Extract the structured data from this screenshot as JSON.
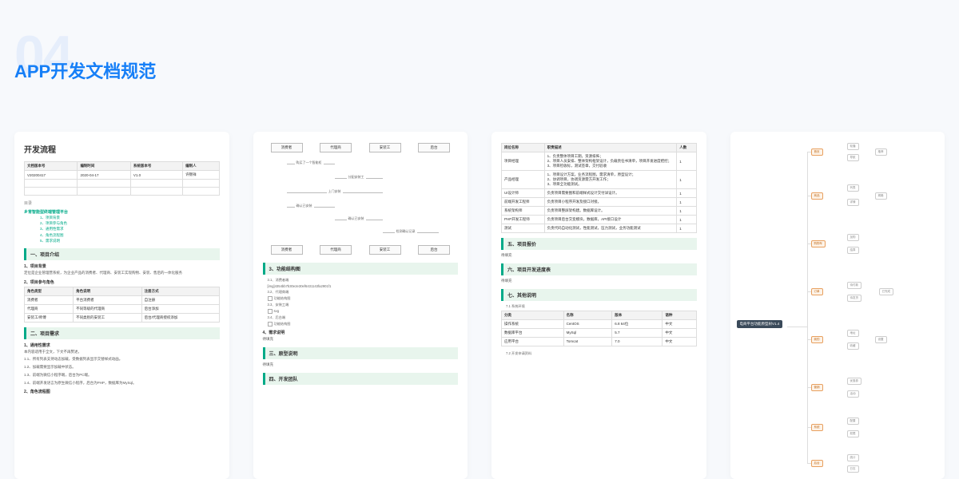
{
  "bg_number": "04",
  "title": "APP开发文档规范",
  "card1": {
    "h1": "开发流程",
    "ver_table": {
      "headers": [
        "文档版本号",
        "编制时间",
        "系统版本号",
        "编制人"
      ],
      "rows": [
        [
          "V20200417",
          "2020-04-17",
          "V1.0",
          "许锦祥"
        ],
        [
          "",
          "",
          "",
          ""
        ],
        [
          "",
          "",
          "",
          ""
        ]
      ]
    },
    "toc_label": "目录",
    "toc_head": "乡育智能型终端管理平台",
    "toc_items": [
      "1、项目背景",
      "2、项目参与角色",
      "3、通用性需求",
      "4、角色流程图",
      "5、需求说明"
    ],
    "sec1": "一、项目介绍",
    "s1_1": "1、项目背景",
    "s1_1_txt": "定位是企业管理营系统，为企业产品的消费者、代理商、安装工实现购物、安装、售后的一体化服务",
    "s1_2": "2、项目参与角色",
    "role_table": {
      "headers": [
        "角色类型",
        "角色说明",
        "注册方式"
      ],
      "rows": [
        [
          "消费者",
          "平台消费者",
          "自注册"
        ],
        [
          "代理商",
          "不同等级的代理商",
          "后台添加"
        ],
        [
          "安装工/师傅",
          "不同类别的安装工",
          "后台/代理商授权添加"
        ]
      ]
    },
    "sec2": "二、项目需求",
    "s2_1": "1、通用性需求",
    "s2_1_txt": "本内容适用于全文，下文不再赘述。",
    "s2_items": [
      "1.1、所有列表支持动态加载，受数据列表显示交替样式动画。",
      "1.2、加载需要显示加载中状态。",
      "1.3、前端为微信小程序端，后台为PC端。",
      "1.4、前端开发语言为原生微信小程序，后台为PHP，数据库为MySql。"
    ],
    "s2_2": "2、角色流程图"
  },
  "card2": {
    "flow_top": [
      "消费者",
      "代理商",
      "安装工",
      "后台"
    ],
    "flow_labels": [
      "购买了一个智能柜",
      "分配安装工",
      "上门安装",
      "确认已安装",
      "确认已安装",
      "检测确认记录"
    ],
    "flow_bot": [
      "消费者",
      "代理商",
      "安装工",
      "后台"
    ],
    "sec3": "3、功能结构图",
    "s3_1": "3.1、消费者端",
    "img_code": "[img]4354bb7b30e2e30ef6431143fa2901f1",
    "s3_2": "3.2、代理商端",
    "icon1": "功能结构图",
    "s3_3": "3.3、安装工端",
    "icon2": "svg",
    "s3_4": "3.4、后台端",
    "icon3": "功能结构图",
    "s4": "4、需求说明",
    "s4_txt": "待填充",
    "sec4": "三、原型说明",
    "sec4_txt": "待填充",
    "sec5": "四、开发团队"
  },
  "card3": {
    "team_table": {
      "headers": [
        "岗位名称",
        "职责描述",
        "人数"
      ],
      "rows": [
        [
          "项目经理",
          "1、负责整体项目工期，资源排佈；\n2、项目人员安排、整体架构框架设计，负载责任书清单，项目开发进度把控；\n3、项目检收标，测试签章，交付验收",
          "1"
        ],
        [
          "产品经理",
          "1、项目设计方案，业务流程图，需求清单，原型设计；\n2、协调项目，协调资源需方开发工作；\n3、项目全功能测试。",
          "1"
        ],
        [
          "UI设计师",
          "负责项目需要图和前端样式设计交付详设计。",
          "1"
        ],
        [
          "前端开发工程师",
          "负责项目小程序开发及接口对接。",
          "1"
        ],
        [
          "系统架构师",
          "负责项目整屏架构建。数据库设计。",
          "1"
        ],
        [
          "PHP开发工程师",
          "负责项目后台交变模块，数据库，API接口设计",
          "1"
        ],
        [
          "测试",
          "负责代码自动化测试，性能测试，压力测试，业务功能测试",
          "1"
        ]
      ]
    },
    "sec6": "五、项目报价",
    "sec6_txt": "待填充",
    "sec7": "六、项目开发进度表",
    "sec7_txt": "待填充",
    "sec8": "七、其他说明",
    "s8_1": "7.1 系统环境",
    "env_table": {
      "headers": [
        "分类",
        "名称",
        "版本",
        "语种"
      ],
      "rows": [
        [
          "操作系统",
          "CentOS",
          "6.8 64位",
          "中文"
        ],
        [
          "数据库平台",
          "MySql",
          "5.7",
          "中文"
        ],
        [
          "应用平台",
          "Tomcat",
          "7.0",
          "中文"
        ]
      ]
    },
    "s8_2": "7.2 开发申请资料"
  },
  "card4": {
    "root": "电商平台功能原型树V1.4",
    "branches": [
      "首页",
      "商品",
      "购物车",
      "订单",
      "我的",
      "营销",
      "系统",
      "后台"
    ]
  }
}
